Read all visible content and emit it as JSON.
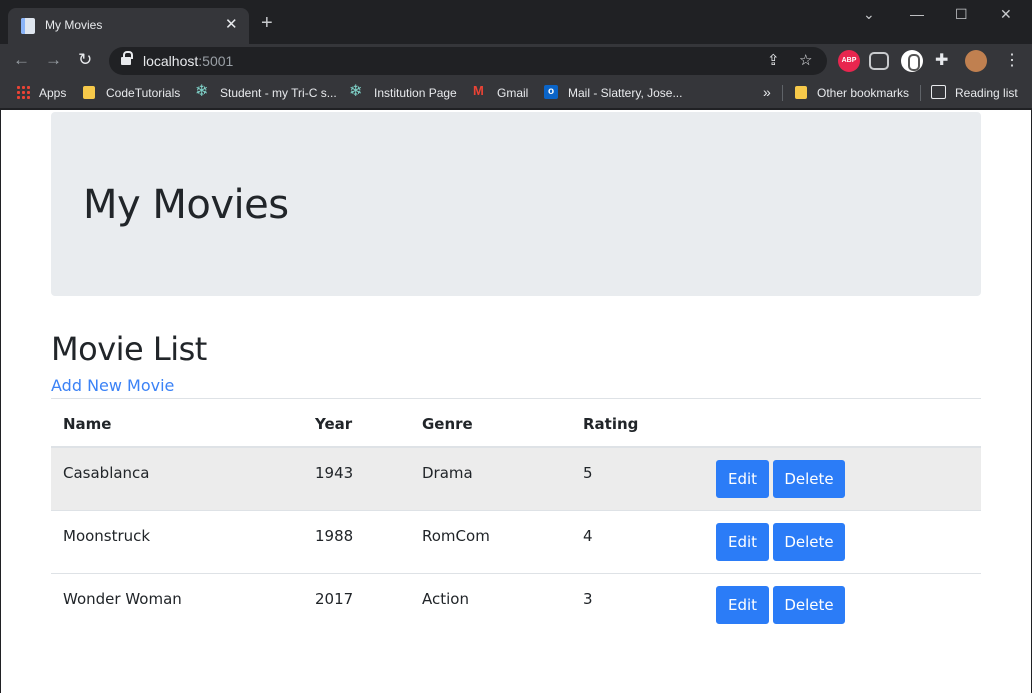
{
  "browser": {
    "tab_title": "My Movies",
    "url_host": "localhost",
    "url_port": ":5001",
    "bookmarks": {
      "apps": "Apps",
      "codetutorials": "CodeTutorials",
      "student": "Student - my Tri-C s...",
      "institution": "Institution Page",
      "gmail": "Gmail",
      "mail": "Mail - Slattery, Jose...",
      "other": "Other bookmarks",
      "reading": "Reading list"
    },
    "extensions": {
      "abp": "ABP"
    }
  },
  "page": {
    "heading": "My Movies",
    "section_title": "Movie List",
    "add_link": "Add New Movie",
    "columns": {
      "name": "Name",
      "year": "Year",
      "genre": "Genre",
      "rating": "Rating"
    },
    "edit_label": "Edit",
    "delete_label": "Delete",
    "movies": [
      {
        "name": "Casablanca",
        "year": "1943",
        "genre": "Drama",
        "rating": "5"
      },
      {
        "name": "Moonstruck",
        "year": "1988",
        "genre": "RomCom",
        "rating": "4"
      },
      {
        "name": "Wonder Woman",
        "year": "2017",
        "genre": "Action",
        "rating": "3"
      }
    ]
  },
  "colors": {
    "accent": "#2b7cf7",
    "link": "#3b82f6",
    "jumbotron": "#e9ecef",
    "chrome_dark": "#202124",
    "chrome_toolbar": "#35363a"
  }
}
